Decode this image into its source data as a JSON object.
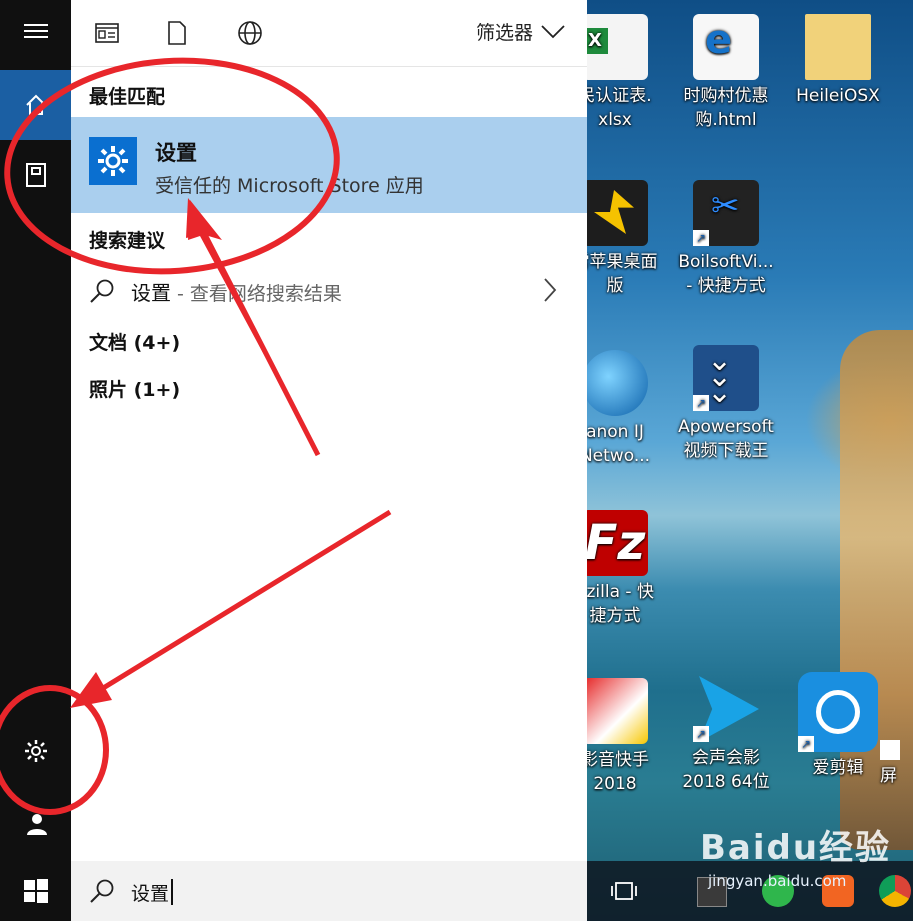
{
  "desktop": {
    "icons": [
      {
        "label_1": "民认证表.",
        "label_2": "xlsx"
      },
      {
        "label_1": "时购村优惠",
        "label_2": "购.html"
      },
      {
        "label_1": "HeileiOSX",
        "label_2": ""
      },
      {
        "label_1": "雷苹果桌面",
        "label_2": "版"
      },
      {
        "label_1": "BoilsoftVi...",
        "label_2": "- 快捷方式"
      },
      {
        "label_1": "anon IJ",
        "label_2": "Netwo..."
      },
      {
        "label_1": "Apowersoft",
        "label_2": "视频下载王"
      },
      {
        "label_1": "ezilla - 快",
        "label_2": "捷方式"
      },
      {
        "label_1": "影音快手",
        "label_2": "2018"
      },
      {
        "label_1": "会声会影",
        "label_2": "2018 64位"
      },
      {
        "label_1": "爱剪辑",
        "label_2": ""
      },
      {
        "label_1": "屏",
        "label_2": ""
      }
    ]
  },
  "rail": {
    "icons": [
      "menu-icon",
      "home-icon",
      "documents-icon",
      "settings-icon",
      "user-icon",
      "windows-icon"
    ]
  },
  "toolbar": {
    "filter_label": "筛选器",
    "icons": [
      "apps-icon",
      "document-icon",
      "web-icon",
      "chevron-down-icon"
    ]
  },
  "results": {
    "best_match_header": "最佳匹配",
    "best_match": {
      "title": "设置",
      "subtitle": "受信任的 Microsoft Store 应用"
    },
    "suggestions_header": "搜索建议",
    "suggestion": {
      "query": "设置",
      "suffix": " - 查看网络搜索结果"
    },
    "documents": "文档 (4+)",
    "photos": "照片 (1+)"
  },
  "search": {
    "value": "设置"
  },
  "watermark": {
    "text": "Baidu经验",
    "url": "jingyan.baidu.com"
  },
  "colors": {
    "highlight": "#aacfee",
    "accent": "#1b5fa3",
    "annotation_red": "#e8262b"
  }
}
